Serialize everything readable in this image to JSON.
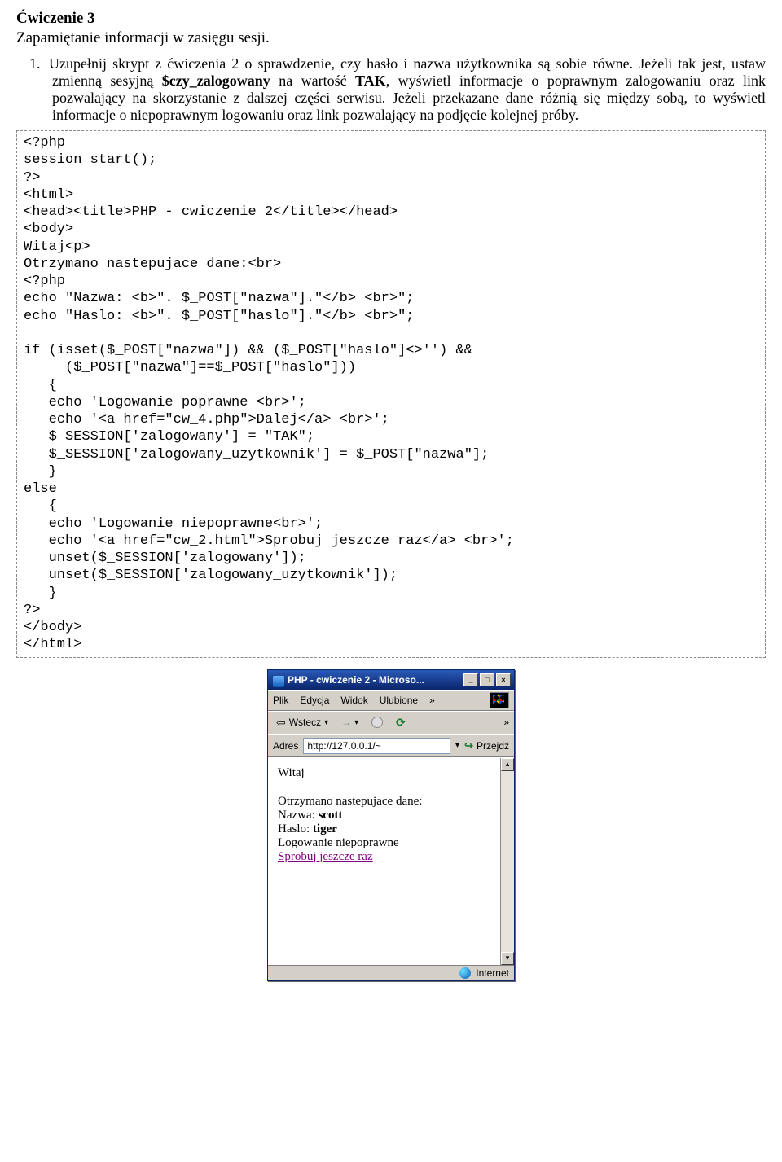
{
  "doc": {
    "title": "Ćwiczenie 3",
    "subtitle": "Zapamiętanie informacji w zasięgu sesji.",
    "step1_num": "1.",
    "step1_p1_a": "Uzupełnij skrypt z ćwiczenia 2 o sprawdzenie, czy hasło i nazwa użytkownika są sobie równe. Jeżeli tak jest, ustaw zmienną sesyjną ",
    "step1_p1_var": "$czy_zalogowany",
    "step1_p1_b": " na wartość ",
    "step1_p1_tak": "TAK",
    "step1_p1_c": ", wyświetl informacje o poprawnym zalogowaniu oraz link pozwalający na skorzystanie z dalszej części serwisu. Jeżeli przekazane dane różnią się między sobą, to wyświetl informacje o niepoprawnym logowaniu oraz link pozwalający na podjęcie kolejnej próby."
  },
  "code": "<?php\nsession_start();\n?>\n<html>\n<head><title>PHP - cwiczenie 2</title></head>\n<body>\nWitaj<p>\nOtrzymano nastepujace dane:<br>\n<?php\necho \"Nazwa: <b>\". $_POST[\"nazwa\"].\"</b> <br>\";\necho \"Haslo: <b>\". $_POST[\"haslo\"].\"</b> <br>\";\n\nif (isset($_POST[\"nazwa\"]) && ($_POST[\"haslo\"]<>'') &&\n     ($_POST[\"nazwa\"]==$_POST[\"haslo\"]))\n   {\n   echo 'Logowanie poprawne <br>';\n   echo '<a href=\"cw_4.php\">Dalej</a> <br>';\n   $_SESSION['zalogowany'] = \"TAK\";\n   $_SESSION['zalogowany_uzytkownik'] = $_POST[\"nazwa\"];\n   }\nelse\n   {\n   echo 'Logowanie niepoprawne<br>';\n   echo '<a href=\"cw_2.html\">Sprobuj jeszcze raz</a> <br>';\n   unset($_SESSION['zalogowany']);\n   unset($_SESSION['zalogowany_uzytkownik']);\n   }\n?>\n</body>\n</html>",
  "browser": {
    "title": "PHP - cwiczenie 2 - Microso...",
    "menu": {
      "plik": "Plik",
      "edycja": "Edycja",
      "widok": "Widok",
      "ulubione": "Ulubione",
      "more": "»"
    },
    "toolbar": {
      "back": "Wstecz",
      "caret": "▾",
      "more": "»"
    },
    "address": {
      "label": "Adres",
      "value": "http://127.0.0.1/~",
      "dropdown": "▾",
      "go": "Przejdź"
    },
    "page": {
      "witaj": "Witaj",
      "line1": "Otrzymano nastepujace dane:",
      "nazwa_label": "Nazwa: ",
      "nazwa_val": "scott",
      "haslo_label": "Haslo: ",
      "haslo_val": "tiger",
      "log": "Logowanie niepoprawne",
      "link": "Sprobuj jeszcze raz"
    },
    "status": "Internet",
    "winbtn": {
      "min": "_",
      "max": "□",
      "close": "×"
    },
    "scroll": {
      "up": "▴",
      "down": "▾"
    }
  }
}
